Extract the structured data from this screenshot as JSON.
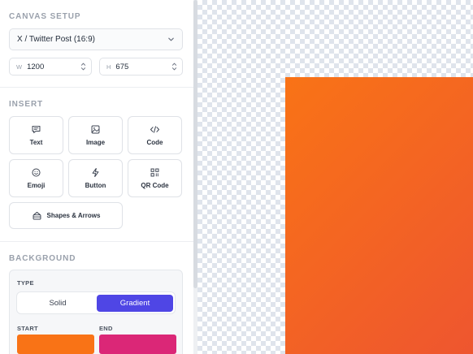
{
  "canvas_setup": {
    "title": "CANVAS SETUP",
    "preset": "X / Twitter Post (16:9)",
    "width_prefix": "W",
    "width": "1200",
    "height_prefix": "H",
    "height": "675"
  },
  "insert": {
    "title": "INSERT",
    "items": [
      {
        "label": "Text",
        "icon": "message-square-icon"
      },
      {
        "label": "Image",
        "icon": "image-icon"
      },
      {
        "label": "Code",
        "icon": "code-icon"
      },
      {
        "label": "Emoji",
        "icon": "smile-icon"
      },
      {
        "label": "Button",
        "icon": "lightning-icon"
      },
      {
        "label": "QR Code",
        "icon": "qr-code-icon"
      }
    ],
    "shapes_label": "Shapes & Arrows"
  },
  "background": {
    "title": "BACKGROUND",
    "type_label": "TYPE",
    "options": [
      "Solid",
      "Gradient"
    ],
    "selected": "Gradient",
    "start_label": "START",
    "end_label": "END",
    "start_color": "#f97316",
    "end_color": "#db2777"
  },
  "colors": {
    "accent": "#4f46e5",
    "artboard_start": "#f97316",
    "artboard_end": "#ee5530"
  }
}
